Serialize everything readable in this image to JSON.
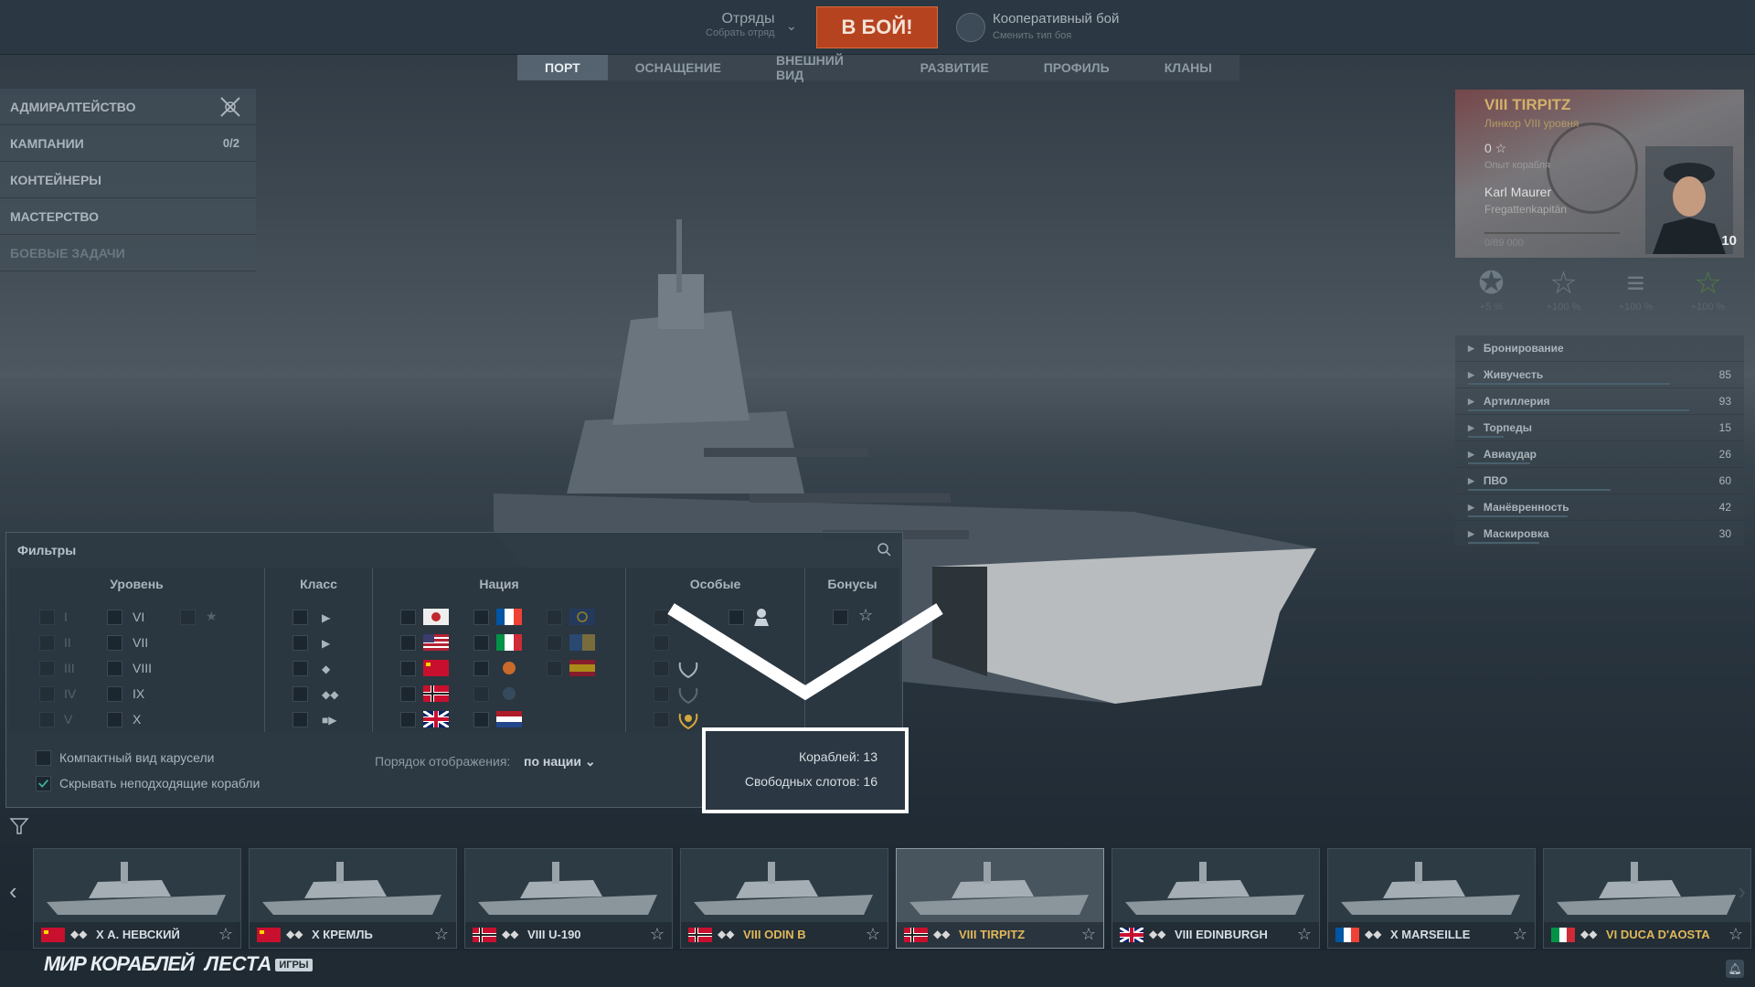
{
  "topbar": {
    "squad_title": "Отряды",
    "squad_sub": "Собрать отряд",
    "battle_label": "В БОЙ!",
    "mode_title": "Кооперативный бой",
    "mode_sub": "Сменить тип боя"
  },
  "tabs": [
    "ПОРТ",
    "ОСНАЩЕНИЕ",
    "ВНЕШНИЙ ВИД",
    "РАЗВИТИЕ",
    "ПРОФИЛЬ",
    "КЛАНЫ"
  ],
  "left_menu": [
    {
      "label": "АДМИРАЛТЕЙСТВО",
      "value": ""
    },
    {
      "label": "КАМПАНИИ",
      "value": "0/2"
    },
    {
      "label": "КОНТЕЙНЕРЫ",
      "value": ""
    },
    {
      "label": "МАСТЕРСТВО",
      "value": ""
    },
    {
      "label": "БОЕВЫЕ ЗАДАЧИ",
      "value": ""
    }
  ],
  "ship_card": {
    "title": "VIII TIRPITZ",
    "subtitle": "Линкор VIII уровня",
    "exp": "0",
    "exp_label": "Опыт корабля",
    "commander": "Karl Maurer",
    "rank": "Fregattenkapitän",
    "xp": "0/89 000",
    "level": "10"
  },
  "bonuses": [
    {
      "icon": "medal-icon",
      "value": "+5 %"
    },
    {
      "icon": "star-icon",
      "value": "+100 %"
    },
    {
      "icon": "flag-stripes-icon",
      "value": "+100 %"
    },
    {
      "icon": "star-green-icon",
      "value": "+100 %"
    }
  ],
  "stats": [
    {
      "label": "Бронирование",
      "value": "",
      "fill": 0
    },
    {
      "label": "Живучесть",
      "value": "85",
      "fill": 0.85
    },
    {
      "label": "Артиллерия",
      "value": "93",
      "fill": 0.93
    },
    {
      "label": "Торпеды",
      "value": "15",
      "fill": 0.15
    },
    {
      "label": "Авиаудар",
      "value": "26",
      "fill": 0.26
    },
    {
      "label": "ПВО",
      "value": "60",
      "fill": 0.6
    },
    {
      "label": "Манёвренность",
      "value": "42",
      "fill": 0.42
    },
    {
      "label": "Маскировка",
      "value": "30",
      "fill": 0.3
    }
  ],
  "filters": {
    "title": "Фильтры",
    "headers": {
      "level": "Уровень",
      "class": "Класс",
      "nation": "Нация",
      "special": "Особые",
      "bonuses": "Бонусы"
    },
    "tiers": [
      "I",
      "II",
      "III",
      "IV",
      "V",
      "VI",
      "VII",
      "VIII",
      "IX",
      "X"
    ],
    "compact_label": "Компактный вид карусели",
    "hide_label": "Скрывать неподходящие корабли",
    "hide_checked": true,
    "order_label": "Порядок отображения:",
    "order_value": "по нации"
  },
  "highlight": {
    "ships": "Кораблей: 13",
    "slots": "Свободных слотов: 16"
  },
  "carousel": [
    {
      "name": "X А. НЕВСКИЙ",
      "flag": "ussr",
      "premium": false
    },
    {
      "name": "X КРЕМЛЬ",
      "flag": "ussr",
      "premium": false
    },
    {
      "name": "VIII U-190",
      "flag": "germany",
      "premium": false
    },
    {
      "name": "VIII ODIN B",
      "flag": "germany",
      "premium": true
    },
    {
      "name": "VIII TIRPITZ",
      "flag": "germany",
      "premium": true
    },
    {
      "name": "VIII EDINBURGH",
      "flag": "uk",
      "premium": false
    },
    {
      "name": "X MARSEILLE",
      "flag": "france",
      "premium": false
    },
    {
      "name": "VI DUCA D'AOSTA",
      "flag": "italy",
      "premium": true
    }
  ],
  "bottom": {
    "logo1": "МИР КОРАБЛЕЙ",
    "logo2": "ЛЕСТА",
    "logo2_badge": "ИГРЫ"
  },
  "colors": {
    "accent": "#b5431f",
    "premium": "#e1b85a"
  }
}
